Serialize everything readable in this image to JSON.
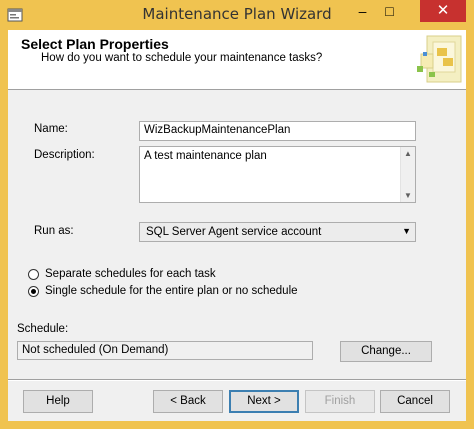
{
  "window": {
    "title": "Maintenance Plan Wizard",
    "min_glyph": "–",
    "max_glyph": "□",
    "close_glyph": "✕"
  },
  "header": {
    "title": "Select Plan Properties",
    "subtitle": "How do you want to schedule your maintenance tasks?"
  },
  "form": {
    "name_label": "Name:",
    "name_value": "WizBackupMaintenancePlan",
    "description_label": "Description:",
    "description_value": "A test maintenance plan",
    "run_as_label": "Run as:",
    "run_as_value": "SQL Server Agent service account",
    "radio_separate": "Separate schedules for each task",
    "radio_single": "Single schedule for the entire plan or no schedule",
    "selected_option": "single",
    "schedule_label": "Schedule:",
    "schedule_value": "Not scheduled (On Demand)",
    "change_label": "Change..."
  },
  "buttons": {
    "help": "Help",
    "back": "< Back",
    "next": "Next >",
    "finish": "Finish",
    "cancel": "Cancel"
  },
  "colors": {
    "title_bar": "#f0c350",
    "close_button": "#c7312f",
    "dialog_body": "#f0f0f0"
  }
}
